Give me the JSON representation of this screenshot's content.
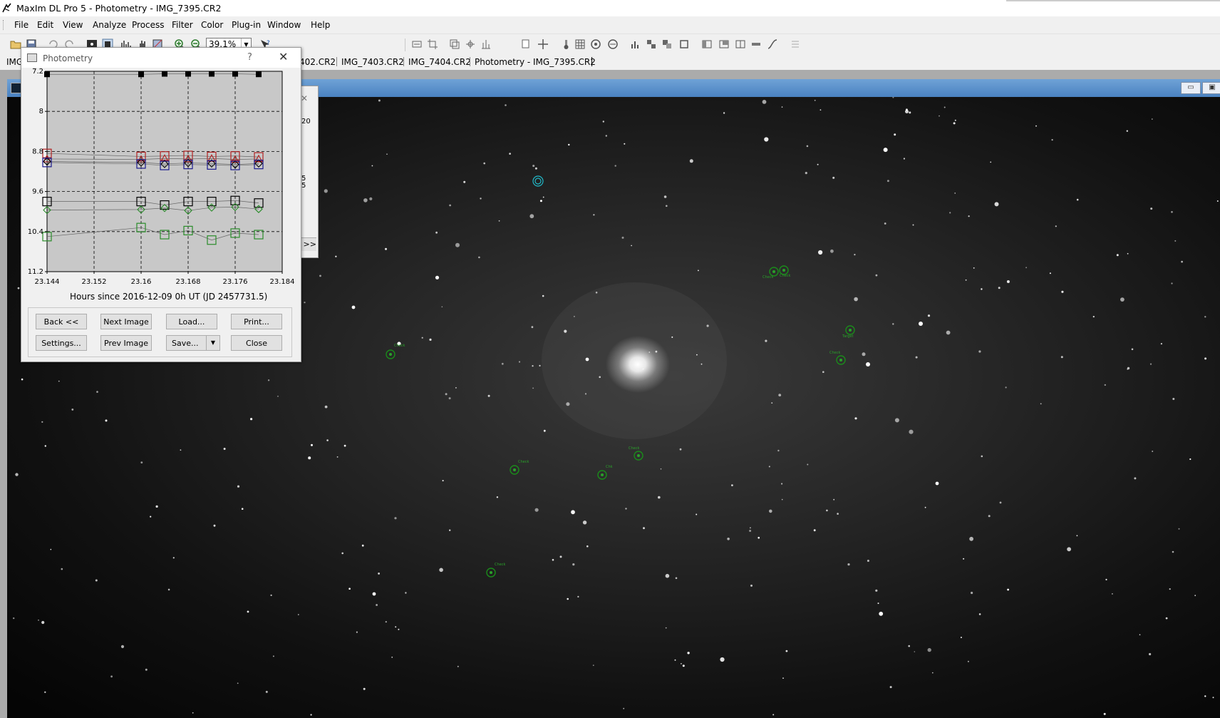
{
  "window": {
    "title": "MaxIm DL Pro 5 - Photometry - IMG_7395.CR2"
  },
  "menu": [
    "File",
    "Edit",
    "View",
    "Analyze",
    "Process",
    "Filter",
    "Color",
    "Plug-in",
    "Window",
    "Help"
  ],
  "toolbar": {
    "zoom_value": "39.1%"
  },
  "tabs": [
    "IMG",
    "402.CR2",
    "IMG_7403.CR2",
    "IMG_7404.CR2",
    "Photometry - IMG_7395.CR2"
  ],
  "photometry_dialog": {
    "title": "Photometry",
    "help_label": "?",
    "close_label": "✕",
    "buttons": {
      "back": "Back <<",
      "next_image": "Next Image",
      "load": "Load...",
      "print": "Print...",
      "settings": "Settings...",
      "prev_image": "Prev Image",
      "save": "Save...",
      "close": "Close"
    }
  },
  "behind_dialog": {
    "close_glyph": "✕",
    "t1": "20",
    "t2": "5",
    "t3": "5",
    "button": "e >>"
  },
  "chart_data": {
    "type": "scatter",
    "xlabel": "Hours since 2016-12-09 0h UT (JD 2457731.5)",
    "ylabel": "",
    "xlim": [
      23.144,
      23.184
    ],
    "ylim": [
      11.2,
      7.2
    ],
    "y_inverted": true,
    "grid": true,
    "x_ticks": [
      "23.144",
      "23.152",
      "23.16",
      "23.168",
      "23.176",
      "23.184"
    ],
    "y_ticks": [
      "7.2",
      "8",
      "8.8",
      "9.6",
      "10.4",
      "11.2"
    ],
    "x": [
      23.144,
      23.16,
      23.164,
      23.168,
      23.172,
      23.176,
      23.18
    ],
    "series": [
      {
        "marker": "filled-square",
        "color": "#000000",
        "values": [
          7.26,
          7.26,
          7.25,
          7.25,
          7.25,
          7.25,
          7.26
        ]
      },
      {
        "marker": "square",
        "color": "#b22222",
        "values": [
          8.84,
          8.9,
          8.89,
          8.88,
          8.9,
          8.89,
          8.91
        ]
      },
      {
        "marker": "triangle",
        "color": "#b22222",
        "values": [
          8.95,
          8.96,
          8.94,
          8.95,
          8.94,
          8.96,
          8.95
        ]
      },
      {
        "marker": "diamond",
        "color": "#000000",
        "values": [
          9.0,
          9.02,
          9.05,
          9.03,
          9.04,
          9.06,
          9.04
        ]
      },
      {
        "marker": "square",
        "color": "#1a1a8c",
        "values": [
          9.02,
          9.05,
          9.08,
          9.06,
          9.07,
          9.08,
          9.06
        ]
      },
      {
        "marker": "square",
        "color": "#000000",
        "values": [
          9.8,
          9.8,
          9.87,
          9.8,
          9.8,
          9.78,
          9.83
        ]
      },
      {
        "marker": "diamond",
        "color": "#2a8c2a",
        "values": [
          9.97,
          9.96,
          9.93,
          9.98,
          9.92,
          9.91,
          9.95
        ]
      },
      {
        "marker": "square",
        "color": "#2a8c2a",
        "values": [
          10.5,
          10.32,
          10.46,
          10.38,
          10.57,
          10.43,
          10.46
        ]
      }
    ]
  },
  "image": {
    "aperture_labels": [
      "Check",
      "Check",
      "Target",
      "Check",
      "Check",
      "Check",
      "Chk",
      "Check",
      "Check"
    ]
  }
}
